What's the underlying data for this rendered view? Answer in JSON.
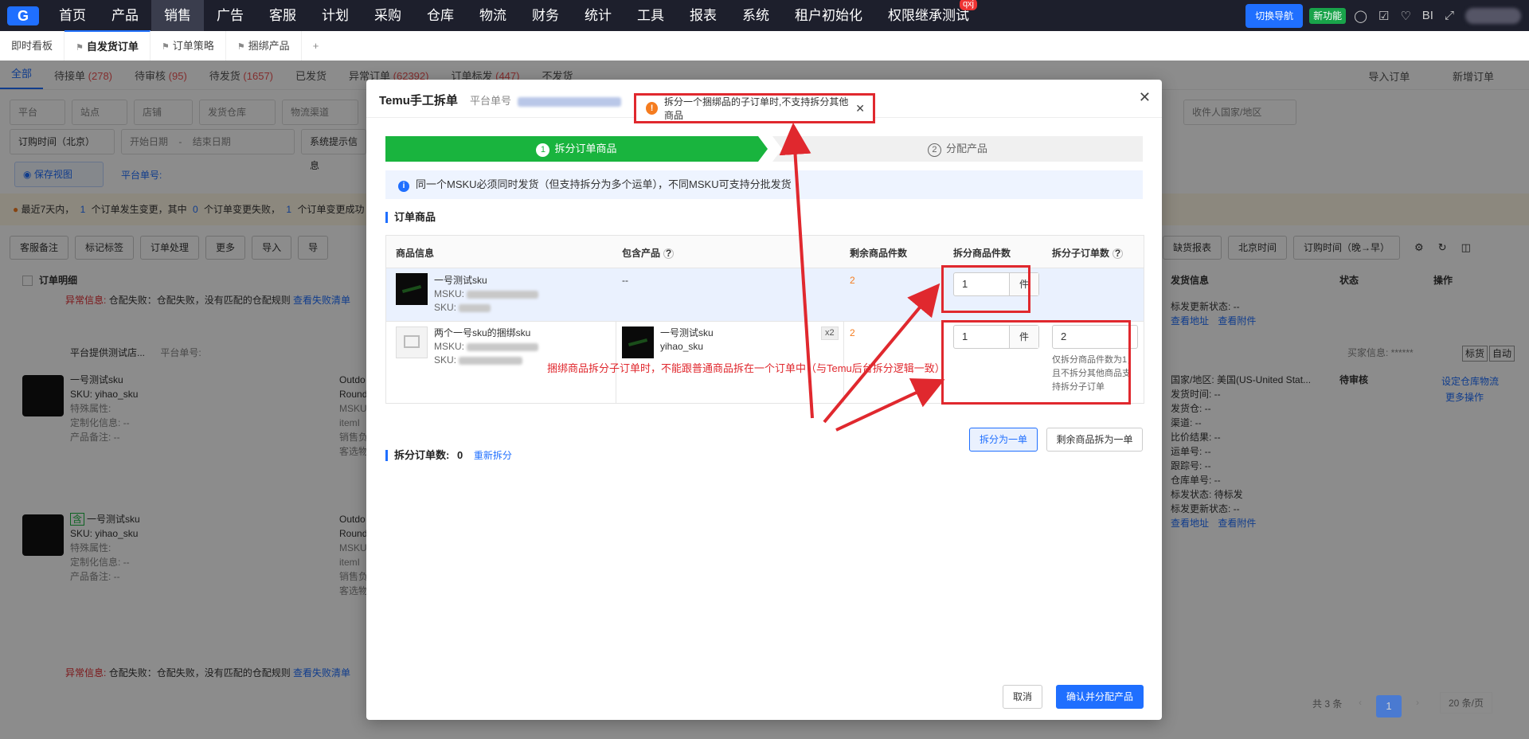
{
  "topnav": {
    "logo": "G",
    "items": [
      "首页",
      "产品",
      "销售",
      "广告",
      "客服",
      "计划",
      "采购",
      "仓库",
      "物流",
      "财务",
      "统计",
      "工具",
      "报表",
      "系统",
      "租户初始化",
      "权限继承测试"
    ],
    "active_index": 2,
    "badge": "qxj",
    "switch_label": "切换导航",
    "new_label": "新功能",
    "bi_label": "BI"
  },
  "tabs": [
    {
      "label": "即时看板"
    },
    {
      "label": "自发货订单"
    },
    {
      "label": "订单策略"
    },
    {
      "label": "捆绑产品"
    },
    {
      "label": "+"
    }
  ],
  "status_tabs": {
    "all": "全部",
    "pending_accept": "待接单",
    "pending_accept_num": "(278)",
    "pending_review": "待审核",
    "pending_review_num": "(95)",
    "pending_ship": "待发货",
    "pending_ship_num": "(1657)",
    "shipped": "已发货",
    "abnormal": "异常订单",
    "abnormal_num": "(62392)",
    "order_mark": "订单标发",
    "order_mark_num": "(447)",
    "not_shipped": "不发货",
    "import_label": "导入订单",
    "add_label": "新增订单"
  },
  "filters": {
    "platform": "平台",
    "site": "站点",
    "store": "店铺",
    "warehouse": "发货仓库",
    "channel": "物流渠道",
    "recv_country": "收件人国家/地区",
    "order_time": "订购时间（北京）",
    "start_date": "开始日期",
    "dash": "-",
    "end_date": "结束日期",
    "sys_hint": "系统提示信息",
    "save_view": "保存视图",
    "platform_no": "平台单号:"
  },
  "warning": {
    "text1": "最近7天内，",
    "n1": "1",
    "text2": "个订单发生变更，其中",
    "n2": "0",
    "text3": "个订单变更失败，",
    "n3": "1",
    "text4": "个订单变更成功"
  },
  "toolbar": {
    "cs_note": "客服备注",
    "mark_tag": "标记标签",
    "order_process": "订单处理",
    "more": "更多",
    "import": "导入",
    "export": "导",
    "stock_report": "缺货报表",
    "bj_time": "北京时间",
    "order_time_sort": "订购时间（晚→早）"
  },
  "bg_table": {
    "col_detail": "订单明细",
    "col_ship": "发货信息",
    "col_status": "状态",
    "col_ops": "操作",
    "err1_label": "异常信息:",
    "err1_text": "仓配失败：仓配失败，没有匹配的仓配规则",
    "err_link": "查看失败清单",
    "store_name": "平台提供测试店...",
    "platform_no": "平台单号:",
    "buyer_label": "买家信息: ****** ",
    "tag_mark": "标货",
    "tag_auto": "自动",
    "items": [
      {
        "name": "一号测试sku",
        "sku": "SKU: yihao_sku",
        "attr": "特殊属性:",
        "custom": "定制化信息: --",
        "note": "产品备注: -- "
      },
      {
        "name": "一号测试sku",
        "sku": "SKU: yihao_sku",
        "attr": "特殊属性:",
        "custom": "定制化信息: --",
        "note": "产品备注: -- ",
        "tag": "含"
      }
    ],
    "outdo": [
      "Outdo",
      "Round",
      "MSKU",
      "itemI",
      "销售负",
      "客选物"
    ],
    "ship_info": {
      "country": "国家/地区: 美国(US-United Stat...",
      "ship_time": "发货时间: --",
      "warehouse": "发货仓: --",
      "channel": "渠道: --",
      "compare": "比价结果: --",
      "waybill": "运单号: --",
      "tracking": "跟踪号: --",
      "wh_no": "仓库单号: --",
      "mark_status": "标发状态: 待标发",
      "mark_update": "标发更新状态: --",
      "view_addr": "查看地址",
      "view_attach": "查看附件"
    },
    "status_pending": "待审核",
    "set_wh_logistics": "设定仓库物流",
    "more_ops": "更多操作",
    "err2_label": "异常信息:",
    "err2_text": "仓配失败：仓配失败，没有匹配的仓配规则",
    "mark_update_top": "标发更新状态: --"
  },
  "pager": {
    "total": "共 3 条",
    "page": "1",
    "per_page": "20 条/页"
  },
  "modal": {
    "title": "Temu手工拆单",
    "order_label": "平台单号",
    "toast": "拆分一个捆绑品的子订单时,不支持拆分其他商品",
    "step1": "拆分订单商品",
    "step2": "分配产品",
    "info": "同一个MSKU必须同时发货（但支持拆分为多个运单），不同MSKU可支持分批发货",
    "section_items": "订单商品",
    "headers": {
      "product": "商品信息",
      "included": "包含产品",
      "remaining": "剩余商品件数",
      "split_qty": "拆分商品件数",
      "split_sub": "拆分子订单数"
    },
    "rows": [
      {
        "name": "一号测试sku",
        "msku_label": "MSKU:",
        "sku_label": "SKU:",
        "included": "--",
        "remaining": "2",
        "split_qty": "1",
        "unit": "件"
      },
      {
        "name": "两个一号sku的捆绑sku",
        "msku_label": "MSKU:",
        "sku_label": "SKU:",
        "inc_name": "一号测试sku",
        "inc_sku": "yihao_sku",
        "inc_qty": "x2",
        "remaining": "2",
        "split_qty": "1",
        "unit": "件",
        "sub_count": "2",
        "hint": "仅拆分商品件数为1，且不拆分其他商品支持拆分子订单"
      }
    ],
    "btn_split_one": "拆分为一单",
    "btn_rest_one": "剩余商品拆为一单",
    "split_count_label": "拆分订单数:",
    "split_count": "0",
    "resplit": "重新拆分",
    "annotation": "捆绑商品拆分子订单时，不能跟普通商品拆在一个订单中（与Temu后台拆分逻辑一致）",
    "cancel": "取消",
    "confirm": "确认并分配产品"
  }
}
